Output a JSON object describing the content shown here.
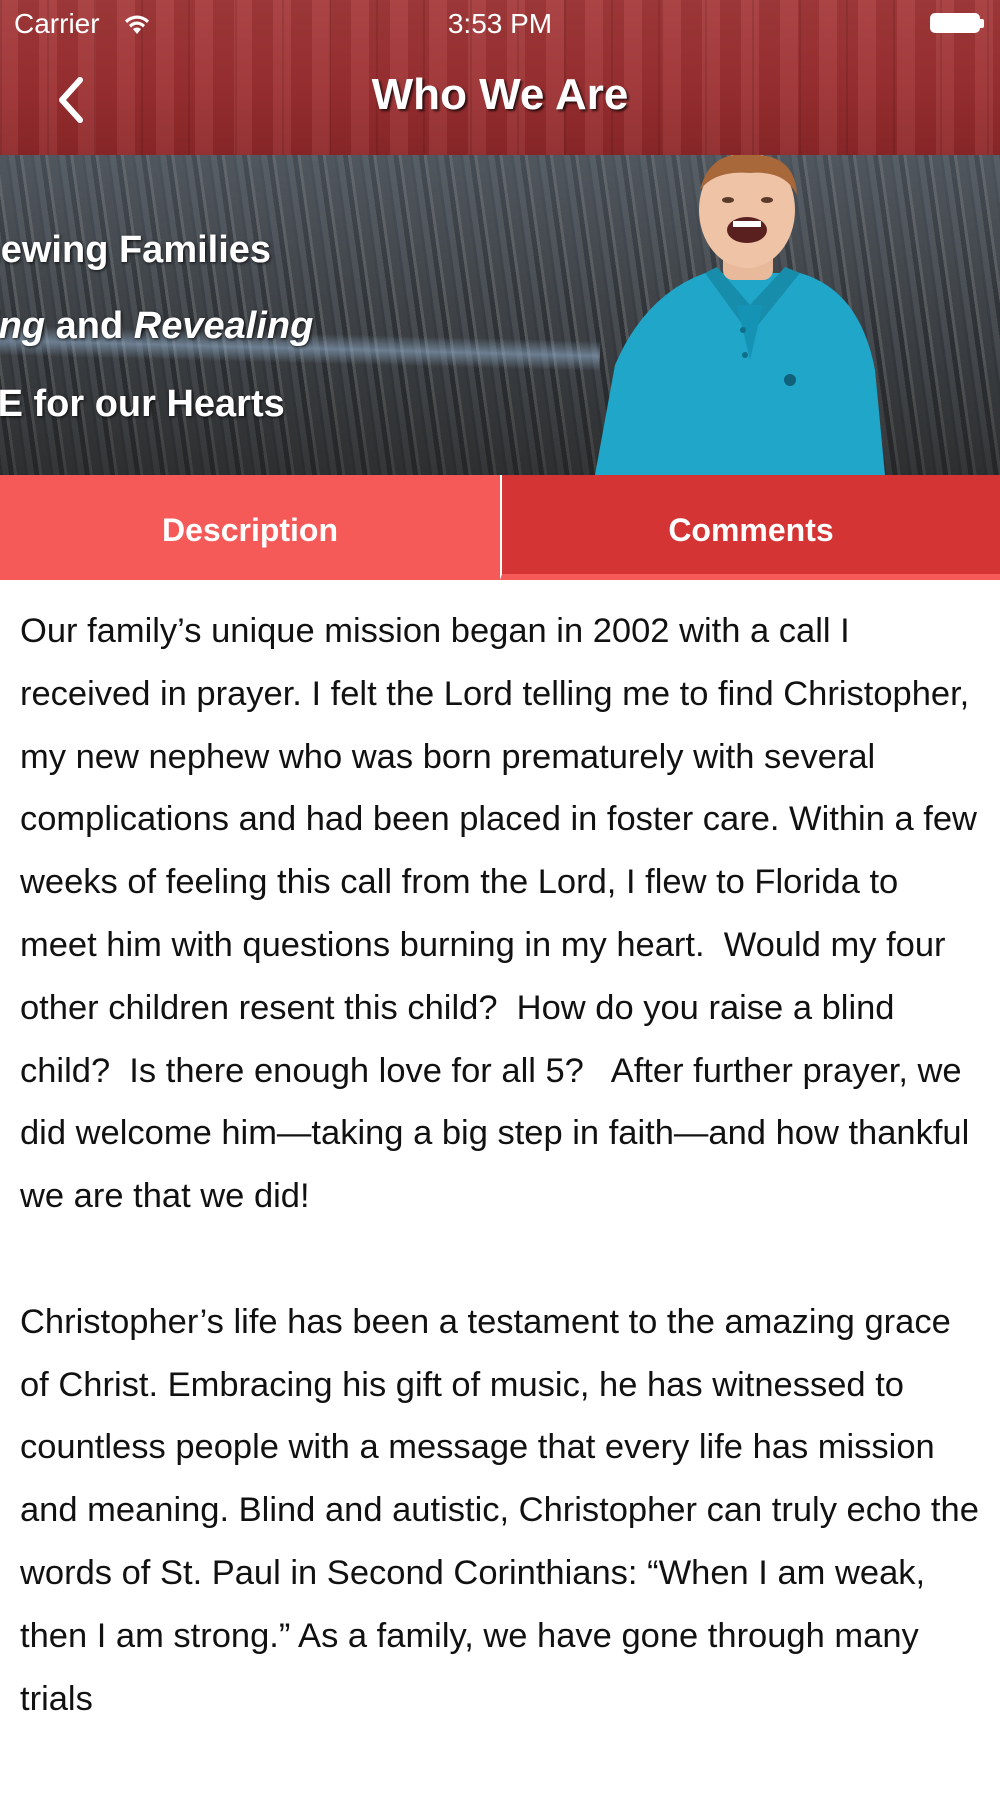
{
  "status_bar": {
    "carrier": "Carrier",
    "time": "3:53 PM"
  },
  "nav": {
    "title": "Who We Are",
    "back_icon": "chevron-left-icon"
  },
  "banner": {
    "line1": "Renewing Families",
    "line2_part1": "Reviving",
    "line2_part2": " and ",
    "line2_part3": "Revealing",
    "line3": "HOPE for our Hearts"
  },
  "tabs": {
    "description": "Description",
    "comments": "Comments",
    "selected": "Description"
  },
  "content": {
    "paragraph1": "Our family’s unique mission began in 2002 with a call I received in prayer. I felt the Lord telling me to find Christopher, my new nephew who was born prematurely with several complications and had been placed in foster care. Within a few weeks of feeling this call from the Lord, I flew to Florida to meet him with questions burning in my heart.  Would my four other children resent this child?  How do you raise a blind child?  Is there enough love for all 5?   After further prayer, we did welcome him—taking a big step in faith—and how thankful we are that we did!",
    "paragraph2": "Christopher’s life has been a testament to the amazing grace of Christ. Embracing his gift of music, he has witnessed to countless people with a message that every life has mission and meaning. Blind and autistic, Christopher can truly echo the words of St. Paul in Second Corinthians: “When I am weak, then I am strong.” As a family, we have gone through many trials"
  },
  "colors": {
    "nav_red": "#9c2f31",
    "tab_active": "#f55a58",
    "tab_inactive": "#d53434"
  }
}
